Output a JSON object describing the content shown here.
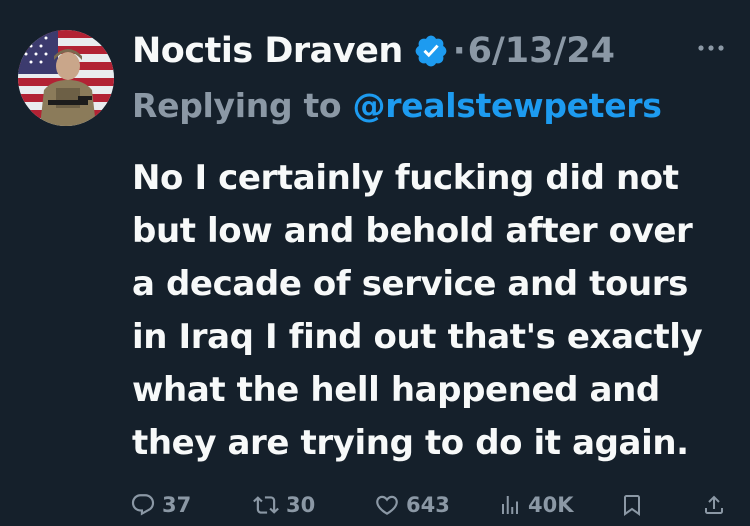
{
  "tweet": {
    "author_name": "Noctis Draven",
    "separator": "·",
    "date": "6/13/24",
    "reply_prefix": "Replying to ",
    "reply_handle": "@realstewpeters",
    "text_lines": [
      "No I certainly fucking did not",
      "but low and behold after over",
      "a decade of service and tours",
      "in Iraq I find out that's exactly",
      "what the hell happened and",
      "they are trying to do it again."
    ],
    "stats": {
      "replies": "37",
      "reposts": "30",
      "likes": "643",
      "views": "40K"
    }
  },
  "icons": {
    "verified": "verified-badge-icon",
    "more": "more-dots-icon",
    "reply": "reply-bubble-icon",
    "repost": "repost-icon",
    "like": "heart-icon",
    "views": "views-chart-icon",
    "bookmark": "bookmark-icon",
    "share": "share-icon"
  },
  "colors": {
    "background": "#15202b",
    "primary_text": "#f7f9f9",
    "secondary_text": "#8b98a5",
    "accent": "#1d9bf0"
  }
}
